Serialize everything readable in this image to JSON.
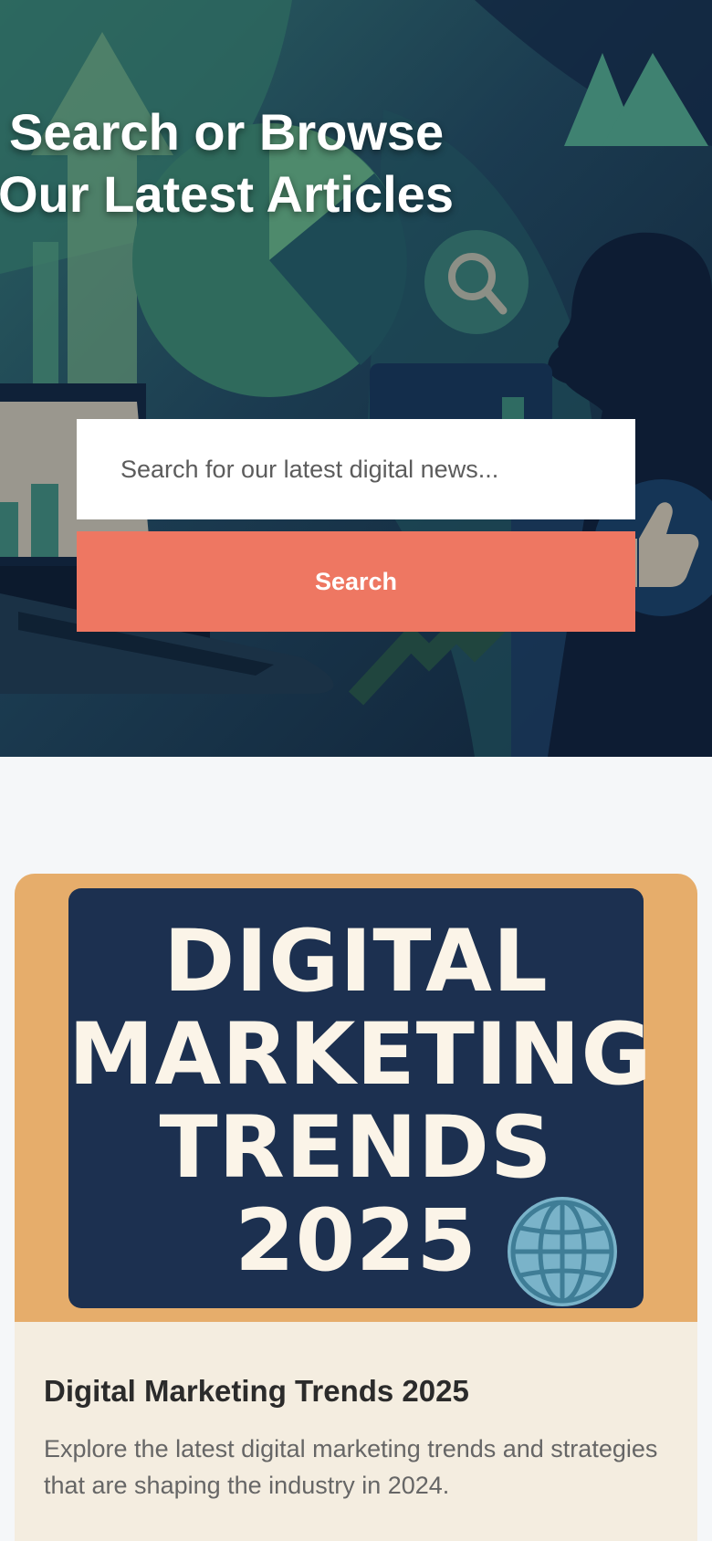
{
  "hero": {
    "title_line1": "Search or Browse",
    "title_line2": "Our Latest Articles"
  },
  "search": {
    "placeholder": "Search for our latest digital news...",
    "value": "",
    "button_label": "Search"
  },
  "articles": [
    {
      "image_text": [
        "DIGITAL",
        "MARKETING",
        "TRENDS",
        "2025"
      ],
      "title": "Digital Marketing Trends 2025",
      "description": "Explore the latest digital marketing trends and strategies that are shaping the industry in 2024."
    }
  ],
  "colors": {
    "hero_dark": "#12263f",
    "hero_green": "#2f6a62",
    "search_button": "#ee7762",
    "card_background": "#f4ede0",
    "card_image_frame": "#e6ad6b",
    "board": "#1c3050",
    "globe": "#7ab3c9"
  },
  "icons": [
    "magnifier-icon",
    "thumbs-up-icon",
    "person-silhouette-icon",
    "laptop-icon",
    "globe-icon"
  ]
}
